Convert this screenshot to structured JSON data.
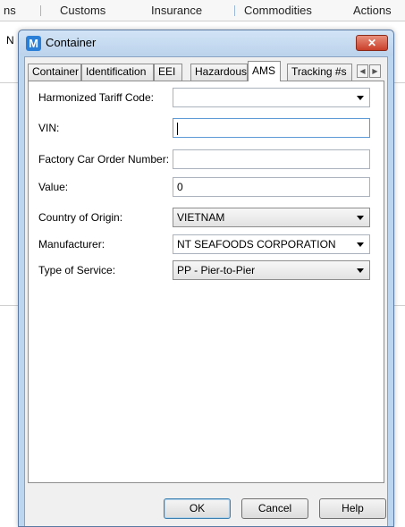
{
  "background": {
    "menu": [
      "ns",
      "Customs",
      "Insurance",
      "Commodities",
      "Actions"
    ],
    "left_letter": "N"
  },
  "dialog": {
    "title": "Container",
    "app_icon_letter": "M",
    "close_glyph": "✕",
    "tabs": [
      {
        "label": "Container",
        "active": false
      },
      {
        "label": "Identification",
        "active": false
      },
      {
        "label": "EEI",
        "active": false
      },
      {
        "label": "Hazardous",
        "active": false
      },
      {
        "label": "AMS",
        "active": true
      },
      {
        "label": "Tracking #s",
        "active": false
      }
    ],
    "tab_scroll": {
      "left": "◀",
      "right": "▶"
    },
    "fields": {
      "hts": {
        "label": "Harmonized Tariff Code:",
        "value": ""
      },
      "vin": {
        "label": "VIN:",
        "value": ""
      },
      "factory": {
        "label": "Factory Car Order Number:",
        "value": ""
      },
      "value": {
        "label": "Value:",
        "value": "0"
      },
      "country": {
        "label": "Country of Origin:",
        "value": "VIETNAM"
      },
      "manufacturer": {
        "label": "Manufacturer:",
        "value": "NT SEAFOODS CORPORATION"
      },
      "service": {
        "label": "Type of Service:",
        "value": "PP - Pier-to-Pier"
      }
    },
    "buttons": {
      "ok": "OK",
      "cancel": "Cancel",
      "help": "Help"
    }
  },
  "colors": {
    "frame": "#bcd6ef",
    "close": "#c9402a",
    "accent": "#2b7fd6"
  }
}
